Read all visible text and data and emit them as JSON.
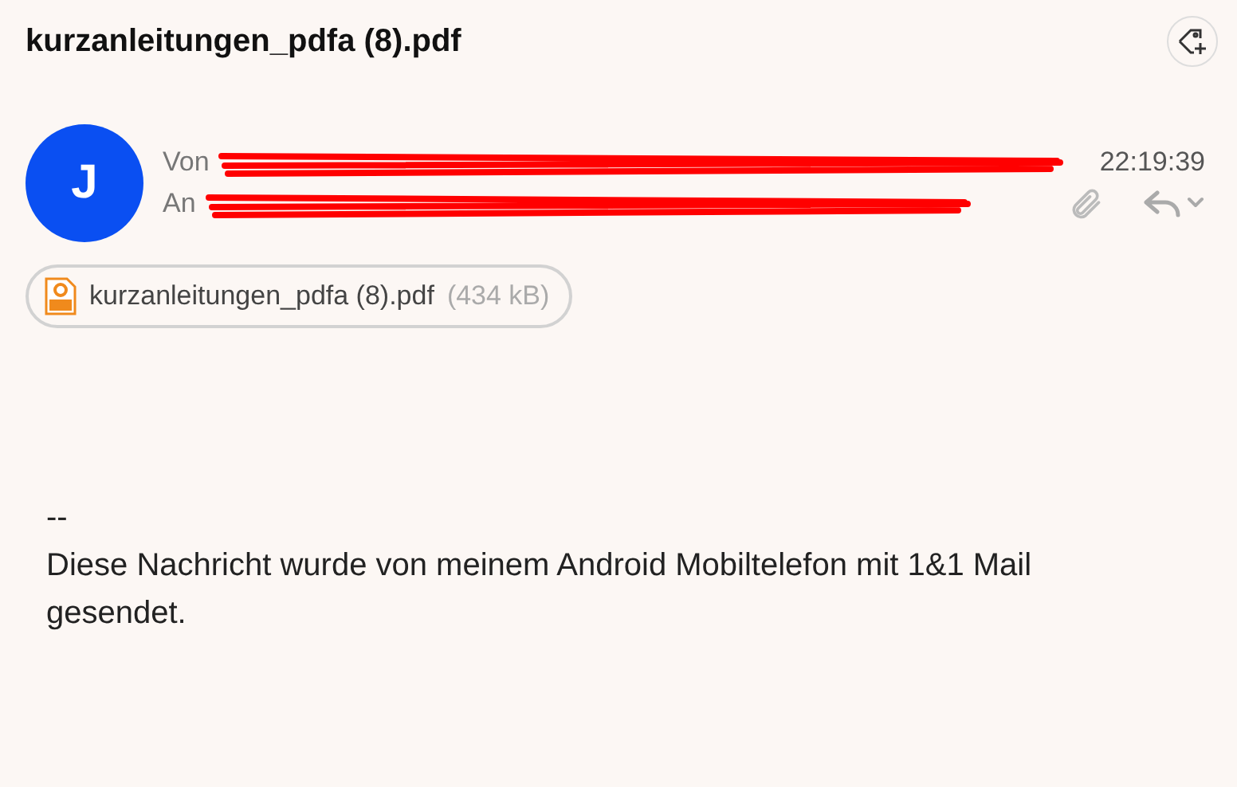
{
  "message": {
    "subject": "kurzanleitungen_pdfa (8).pdf",
    "avatar_initial": "J",
    "from_label": "Von",
    "to_label": "An",
    "time": "22:19:39",
    "attachments": [
      {
        "name": "kurzanleitungen_pdfa (8).pdf",
        "size": "(434 kB)"
      }
    ],
    "body": [
      "--",
      "Diese Nachricht wurde von meinem Android Mobiltelefon mit 1&1 Mail gesendet."
    ]
  }
}
